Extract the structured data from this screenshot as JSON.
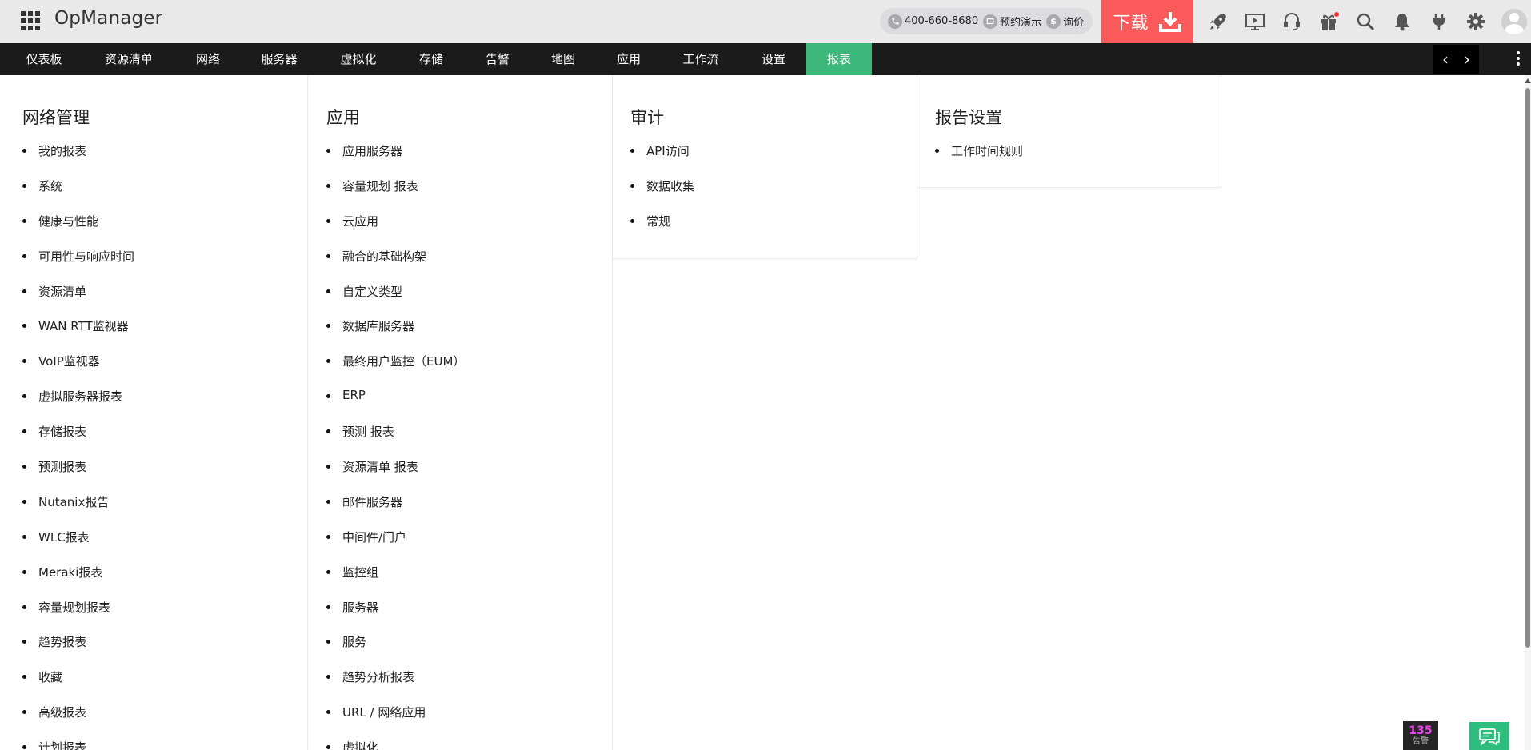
{
  "app": {
    "title": "OpManager"
  },
  "header": {
    "phone": "400-660-8680",
    "demo": "预约演示",
    "quote": "询价",
    "download_label": "下载",
    "icons": [
      "apps-grid-icon",
      "phone-icon",
      "demo-icon",
      "dollar-icon",
      "download-icon",
      "rocket-icon",
      "video-tutorial-icon",
      "support-headset-icon",
      "gift-icon",
      "search-icon",
      "bell-icon",
      "plug-icon",
      "gear-icon",
      "user-avatar-icon"
    ]
  },
  "nav": {
    "items": [
      {
        "label": "仪表板"
      },
      {
        "label": "资源清单"
      },
      {
        "label": "网络"
      },
      {
        "label": "服务器"
      },
      {
        "label": "虚拟化"
      },
      {
        "label": "存储"
      },
      {
        "label": "告警"
      },
      {
        "label": "地图"
      },
      {
        "label": "应用"
      },
      {
        "label": "工作流"
      },
      {
        "label": "设置"
      },
      {
        "label": "报表"
      }
    ],
    "active": "报表",
    "prev_glyph": "‹",
    "next_glyph": "›"
  },
  "menu": {
    "columns": [
      {
        "heading": "网络管理",
        "items": [
          "我的报表",
          "系统",
          "健康与性能",
          "可用性与响应时间",
          "资源清单",
          "WAN RTT监视器",
          "VoIP监视器",
          "虚拟服务器报表",
          "存储报表",
          "预测报表",
          "Nutanix报告",
          "WLC报表",
          "Meraki报表",
          "容量规划报表",
          "趋势报表",
          "收藏",
          "高级报表",
          "计划报表"
        ]
      },
      {
        "heading": "应用",
        "items": [
          "应用服务器",
          "容量规划 报表",
          "云应用",
          "融合的基础构架",
          "自定义类型",
          "数据库服务器",
          "最终用户监控（EUM）",
          "ERP",
          "预测 报表",
          "资源清单 报表",
          "邮件服务器",
          "中间件/门户",
          "监控组",
          "服务器",
          "服务",
          "趋势分析报表",
          "URL / 网络应用",
          "虚拟化"
        ]
      },
      {
        "heading": "审计",
        "items": [
          "API访问",
          "数据收集",
          "常规"
        ]
      },
      {
        "heading": "报告设置",
        "items": [
          "工作时间规则"
        ]
      }
    ]
  },
  "widgets": {
    "alarm_count": "135",
    "alarm_label": "告警"
  },
  "colors": {
    "header_bg": "#e9e9ea",
    "nav_bg": "#1b1b1c",
    "active_tab": "#3db87b",
    "download_bg": "#fb5a5b",
    "chat_bg": "#2ebd7c",
    "alarm_count": "#ea3ff2"
  }
}
